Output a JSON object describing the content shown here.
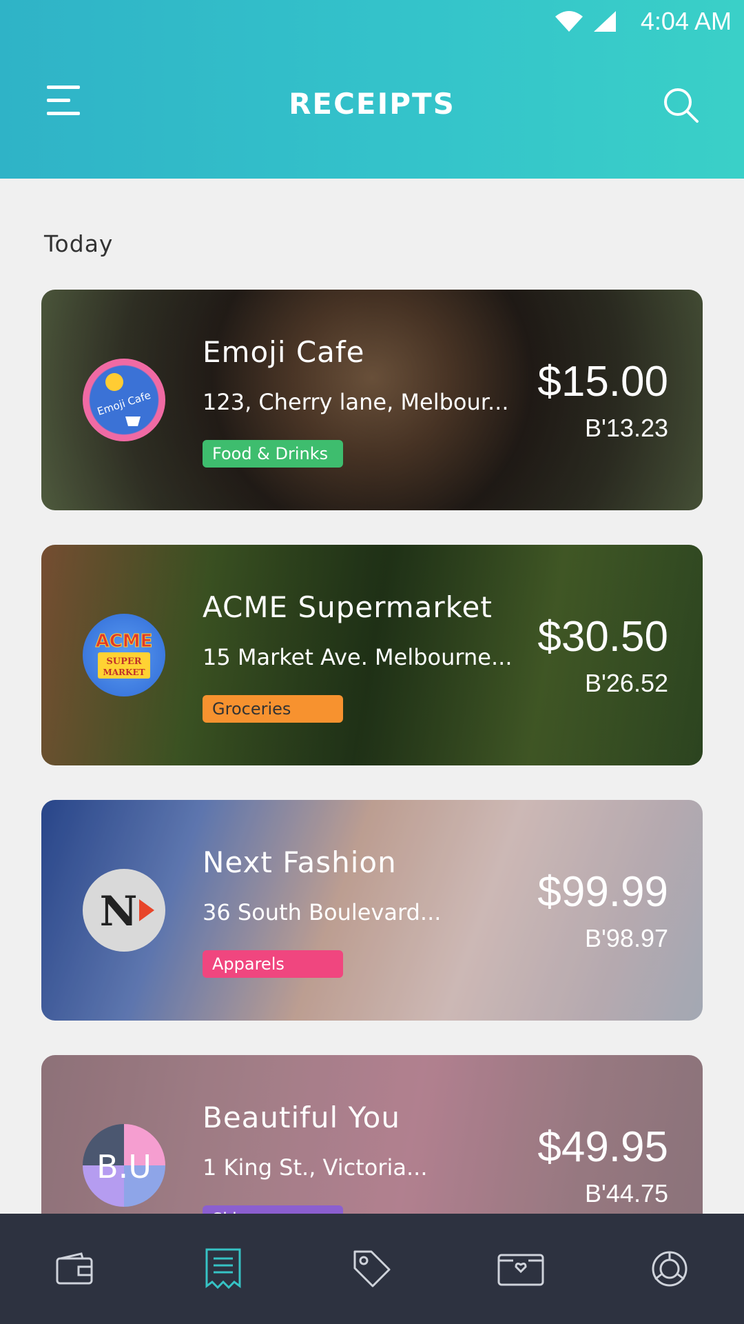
{
  "status_bar": {
    "time": "4:04 AM"
  },
  "header": {
    "title": "RECEIPTS"
  },
  "section": {
    "label": "Today"
  },
  "receipts": [
    {
      "name": "Emoji Cafe",
      "address": "123, Cherry lane, Melbour...",
      "category": "Food & Drinks",
      "category_color": "#3ebd6e",
      "amount": "$15.00",
      "secondary_amount": "B'13.23",
      "logo_text": "Emoji Cafe"
    },
    {
      "name": "ACME Supermarket",
      "address": "15 Market Ave. Melbourne...",
      "category": "Groceries",
      "category_color": "#f7922f",
      "amount": "$30.50",
      "secondary_amount": "B'26.52",
      "logo_text": "ACME"
    },
    {
      "name": "Next Fashion",
      "address": "36 South Boulevard...",
      "category": "Apparels",
      "category_color": "#f0467f",
      "amount": "$99.99",
      "secondary_amount": "B'98.97",
      "logo_text": "N"
    },
    {
      "name": "Beautiful You",
      "address": "1 King St., Victoria...",
      "category": "Skincare",
      "category_color": "#8b5fd0",
      "amount": "$49.95",
      "secondary_amount": "B'44.75",
      "logo_text": "B.U"
    }
  ],
  "nav": {
    "items": [
      {
        "icon": "wallet-icon",
        "active": false
      },
      {
        "icon": "receipt-icon",
        "active": true
      },
      {
        "icon": "tag-icon",
        "active": false
      },
      {
        "icon": "card-heart-icon",
        "active": false
      },
      {
        "icon": "chart-ring-icon",
        "active": false
      }
    ],
    "active_color": "#36c3c5",
    "inactive_color": "#cfd3db"
  }
}
